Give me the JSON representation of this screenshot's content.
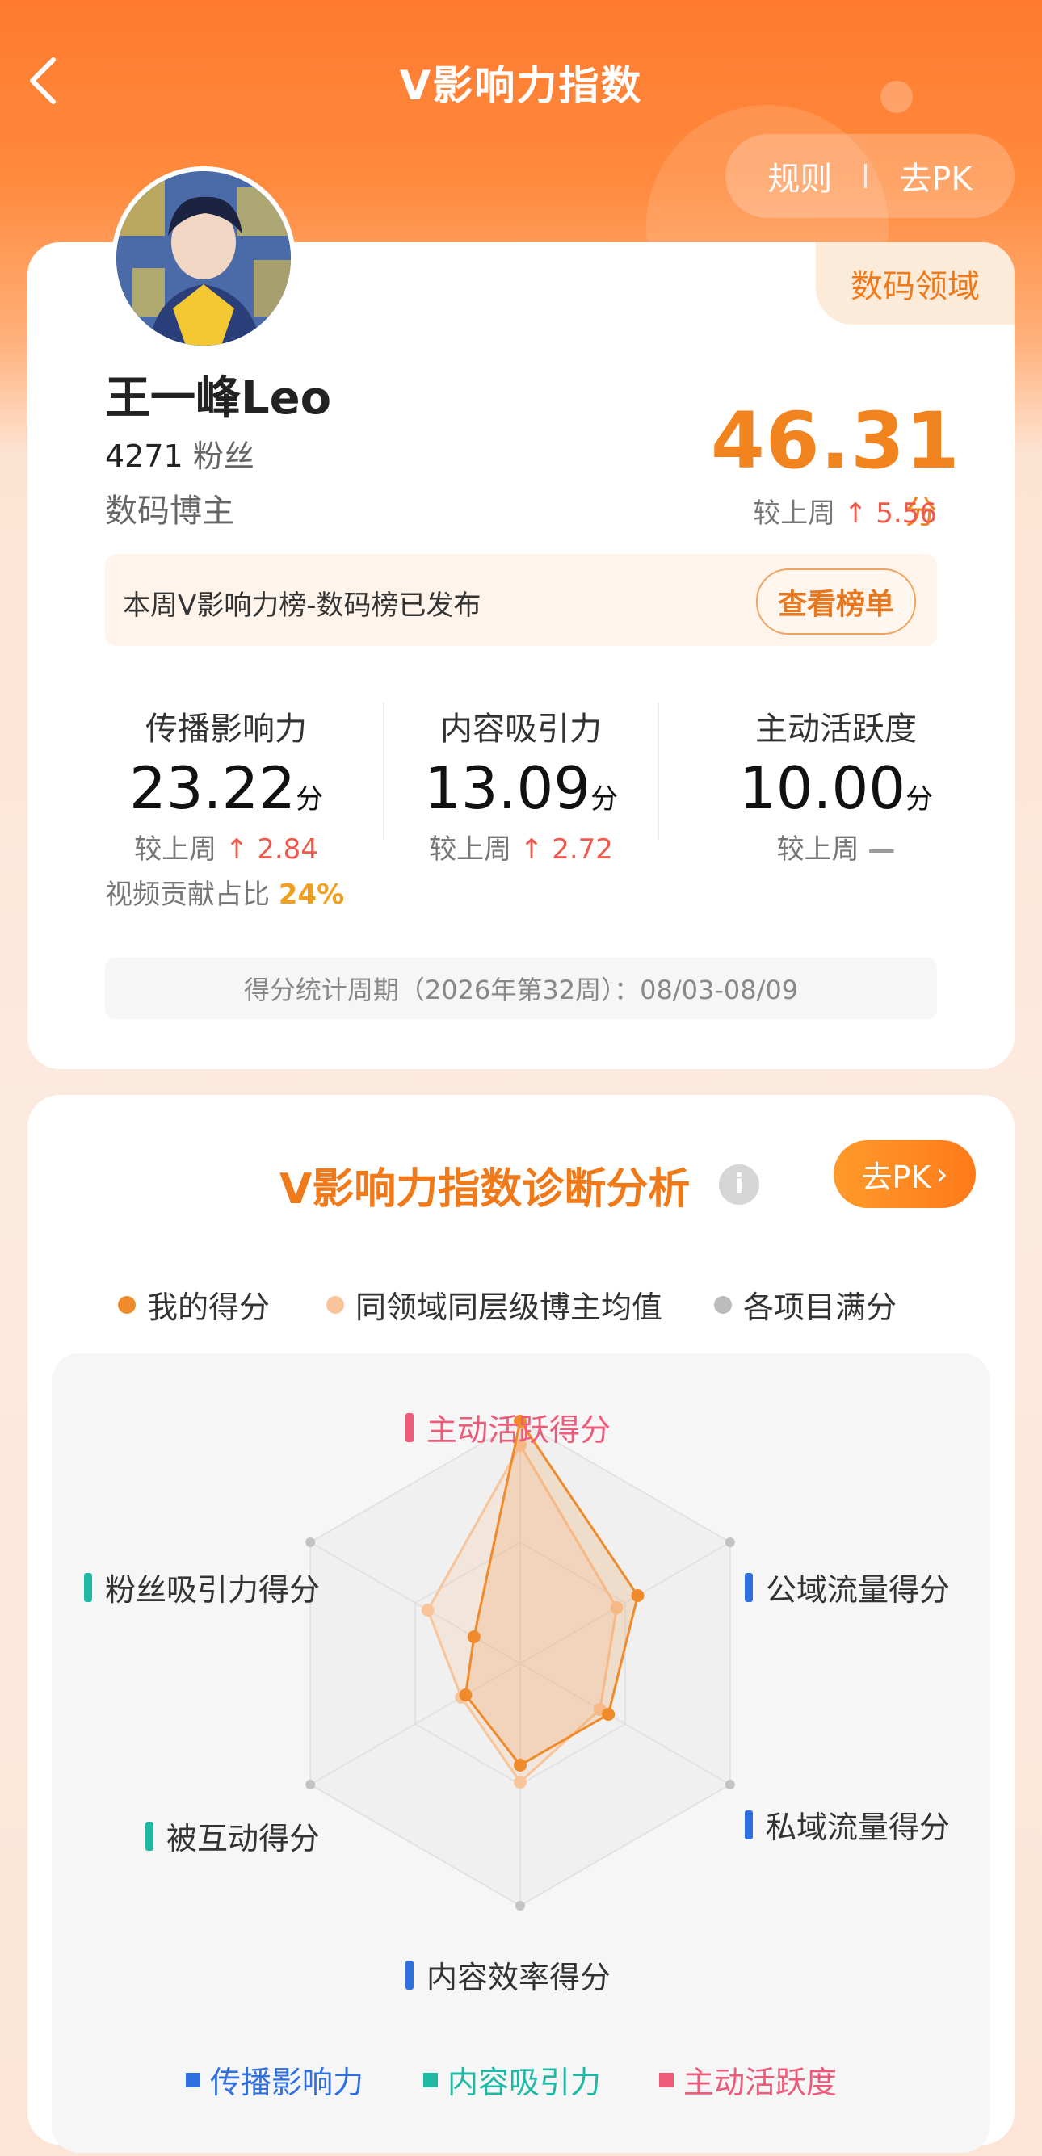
{
  "header": {
    "title": "V影响力指数",
    "rules_label": "规则",
    "pk_label": "去PK"
  },
  "profile": {
    "domain_tag": "数码领域",
    "name": "王一峰Leo",
    "fans_count": "4271",
    "fans_label": "粉丝",
    "role": "数码博主",
    "total_score": "46.31",
    "total_unit": "分",
    "compare_label": "较上周",
    "total_change": "5.56"
  },
  "notice": {
    "text": "本周V影响力榜-数码榜已发布",
    "button": "查看榜单"
  },
  "stats": [
    {
      "label": "传播影响力",
      "value": "23.22",
      "unit": "分",
      "compare": "较上周",
      "change": "2.84",
      "trend": "up"
    },
    {
      "label": "内容吸引力",
      "value": "13.09",
      "unit": "分",
      "compare": "较上周",
      "change": "2.72",
      "trend": "up"
    },
    {
      "label": "主动活跃度",
      "value": "10.00",
      "unit": "分",
      "compare": "较上周",
      "change": "",
      "trend": "flat"
    }
  ],
  "video_ratio": {
    "label": "视频贡献占比",
    "value": "24%"
  },
  "period": "得分统计周期（2026年第32周）：08/03-08/09",
  "diagnosis": {
    "title": "V影响力指数诊断分析",
    "pk_button": "去PK",
    "legend": [
      {
        "label": "我的得分",
        "color": "#f08a2a"
      },
      {
        "label": "同领域同层级博主均值",
        "color": "#f8c49a"
      },
      {
        "label": "各项目满分",
        "color": "#bbbbbb"
      }
    ],
    "axes": [
      {
        "label": "主动活跃得分",
        "color": "#ee5a7a"
      },
      {
        "label": "公域流量得分",
        "color": "#2f6fe0"
      },
      {
        "label": "私域流量得分",
        "color": "#2f6fe0"
      },
      {
        "label": "内容效率得分",
        "color": "#2f6fe0"
      },
      {
        "label": "被互动得分",
        "color": "#1fb8a4"
      },
      {
        "label": "粉丝吸引力得分",
        "color": "#1fb8a4"
      }
    ],
    "my_scores": [
      1.0,
      0.56,
      0.42,
      0.42,
      0.26,
      0.22
    ],
    "avg_scores": [
      0.9,
      0.46,
      0.38,
      0.49,
      0.28,
      0.44
    ],
    "bottom_legend": [
      {
        "label": "传播影响力",
        "color": "#2f6fe0"
      },
      {
        "label": "内容吸引力",
        "color": "#1fb8a4"
      },
      {
        "label": "主动活跃度",
        "color": "#ee5a7a"
      }
    ]
  }
}
